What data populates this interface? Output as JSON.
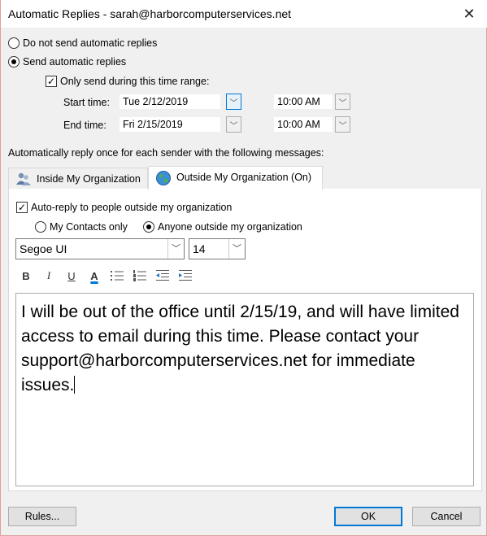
{
  "window": {
    "title": "Automatic Replies - sarah@harborcomputerservices.net",
    "close_glyph": "✕"
  },
  "mode": {
    "do_not_send_label": "Do not send automatic replies",
    "send_label": "Send automatic replies",
    "selected": "send"
  },
  "time_range": {
    "checkbox_label": "Only send during this time range:",
    "checked": true,
    "start_label": "Start time:",
    "start_date": "Tue 2/12/2019",
    "start_time": "10:00 AM",
    "end_label": "End time:",
    "end_date": "Fri 2/15/2019",
    "end_time": "10:00 AM"
  },
  "reply_once_text": "Automatically reply once for each sender with the following messages:",
  "tabs": [
    {
      "label": "Inside My Organization",
      "icon": "people-icon",
      "active": false
    },
    {
      "label": "Outside My Organization (On)",
      "icon": "globe-icon",
      "active": true
    }
  ],
  "outside": {
    "auto_reply_label": "Auto-reply to people outside my organization",
    "auto_reply_checked": true,
    "contacts_only_label": "My Contacts only",
    "anyone_label": "Anyone outside my organization",
    "audience_selected": "anyone"
  },
  "format": {
    "font_name": "Segoe UI",
    "font_size": "14",
    "bold": "B",
    "italic": "I",
    "underline": "U",
    "font_color": "A",
    "accent_color": "#0078d7"
  },
  "message": "I will be out of the office until 2/15/19, and will have limited access to email during this time. Please contact your support@harborcomputerservices.net for immediate issues.",
  "buttons": {
    "rules": "Rules...",
    "ok": "OK",
    "cancel": "Cancel"
  }
}
